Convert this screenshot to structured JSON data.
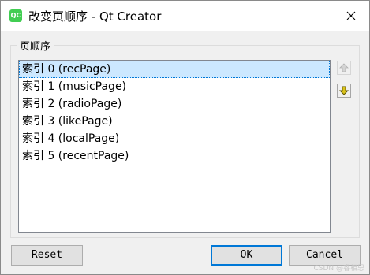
{
  "window": {
    "title": "改变页顺序 - Qt Creator",
    "icon_text": "QC"
  },
  "group": {
    "title": "页顺序"
  },
  "list": {
    "items": [
      "索引 0 (recPage)",
      "索引 1 (musicPage)",
      "索引 2 (radioPage)",
      "索引 3 (likePage)",
      "索引 4 (localPage)",
      "索引 5 (recentPage)"
    ],
    "selected_index": 0
  },
  "side_buttons": {
    "up_icon": "arrow-up-icon",
    "down_icon": "arrow-down-icon",
    "up_enabled": false,
    "down_enabled": true
  },
  "buttons": {
    "reset": "Reset",
    "ok": "OK",
    "cancel": "Cancel"
  },
  "watermark": "CSDN @睿相思",
  "colors": {
    "selection": "#cce8ff",
    "default_button_border": "#0078d7",
    "qt_green": "#41cd52",
    "down_arrow": "#c8a800"
  }
}
